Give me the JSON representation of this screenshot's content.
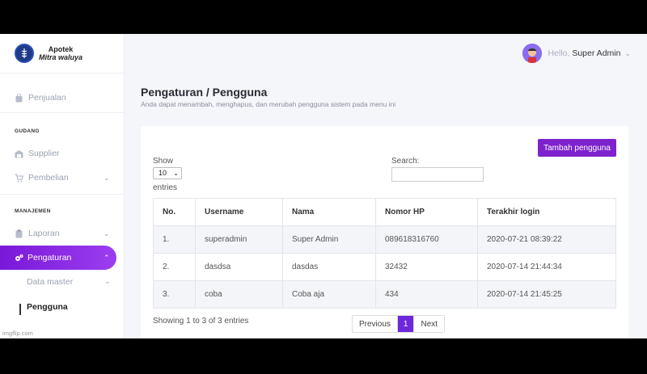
{
  "app": {
    "brand_line1": "Apotek",
    "brand_line2": "Mitra waluya"
  },
  "sidebar": {
    "items": [
      {
        "label": "Penjualan",
        "icon": "bag-icon"
      },
      {
        "section": "GUDANG"
      },
      {
        "label": "Supplier",
        "icon": "warehouse-icon"
      },
      {
        "label": "Pembelian",
        "icon": "cart-icon"
      },
      {
        "section": "MANAJEMEN"
      },
      {
        "label": "Laporan",
        "icon": "clipboard-icon"
      },
      {
        "label": "Pengaturan",
        "icon": "gears-icon",
        "active": true
      },
      {
        "label": "Data master"
      },
      {
        "label": "Pengguna",
        "current": true
      }
    ]
  },
  "topbar": {
    "hello": "Hello,",
    "user_name": "Super Admin"
  },
  "page": {
    "title": "Pengaturan / Pengguna",
    "subtitle": "Anda dapat menambah, menghapus, dan merubah pengguna sistem pada menu ini"
  },
  "toolbar": {
    "add_label": "Tambah pengguna",
    "show_label": "Show",
    "entries_value": "10",
    "entries_label": "entries",
    "search_label": "Search:",
    "search_value": ""
  },
  "table": {
    "columns": [
      "No.",
      "Username",
      "Nama",
      "Nomor HP",
      "Terakhir login"
    ],
    "rows": [
      [
        "1.",
        "superadmin",
        "Super Admin",
        "089618316760",
        "2020-07-21 08:39:22"
      ],
      [
        "2.",
        "dasdsa",
        "dasdas",
        "32432",
        "2020-07-14 21:44:34"
      ],
      [
        "3.",
        "coba",
        "Coba aja",
        "434",
        "2020-07-14 21:45:25"
      ]
    ]
  },
  "footer": {
    "info": "Showing 1 to 3 of 3 entries",
    "previous": "Previous",
    "page": "1",
    "next": "Next"
  },
  "watermark": "imgflip.com",
  "colors": {
    "accent": "#7e22ce",
    "background": "#f5f6fa"
  }
}
